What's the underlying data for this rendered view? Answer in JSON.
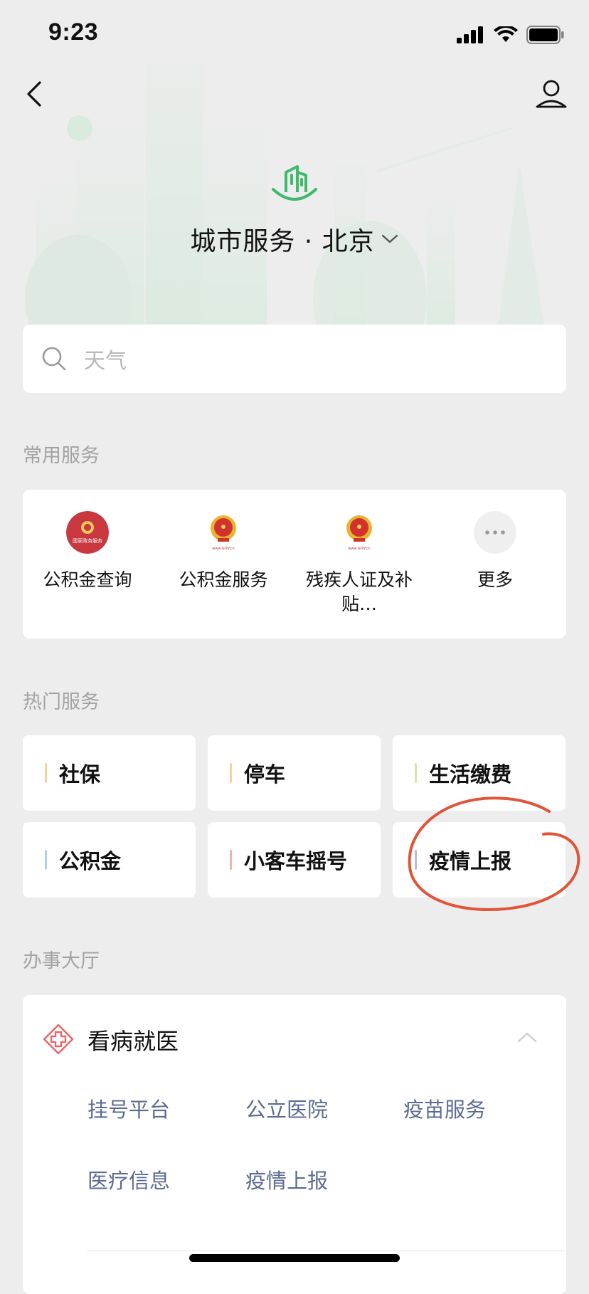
{
  "status_bar": {
    "time": "9:23"
  },
  "header": {
    "title": "城市服务 · 北京"
  },
  "search": {
    "placeholder": "天气"
  },
  "common_services": {
    "title": "常用服务",
    "items": [
      {
        "label": "公积金查询",
        "icon": "national-gov-service-badge",
        "badge_text": "国家政务服务"
      },
      {
        "label": "公积金服务",
        "icon": "national-emblem-icon",
        "caption": "www.GOV.cn"
      },
      {
        "label": "残疾人证及补贴…",
        "icon": "national-emblem-icon",
        "caption": "www.GOV.cn"
      },
      {
        "label": "更多",
        "icon": "more-dots-icon"
      }
    ]
  },
  "hot_services": {
    "title": "热门服务",
    "items": [
      {
        "label": "社保",
        "accent": "#f2d39b"
      },
      {
        "label": "停车",
        "accent": "#f0d49a"
      },
      {
        "label": "生活缴费",
        "accent": "#dde5a0"
      },
      {
        "label": "公积金",
        "accent": "#a9d3ef"
      },
      {
        "label": "小客车摇号",
        "accent": "#efb2b2"
      },
      {
        "label": "疫情上报",
        "accent": "#b6bfd8"
      }
    ]
  },
  "office_hall": {
    "title": "办事大厅",
    "category": {
      "title": "看病就医",
      "icon": "medical-cross-icon",
      "expanded": true
    },
    "links": [
      "挂号平台",
      "公立医院",
      "疫苗服务",
      "医疗信息",
      "疫情上报"
    ]
  },
  "colors": {
    "background": "#ededed",
    "brand_green": "#3fba6b",
    "link": "#5b6b91",
    "annotation_red": "#e0553a"
  }
}
